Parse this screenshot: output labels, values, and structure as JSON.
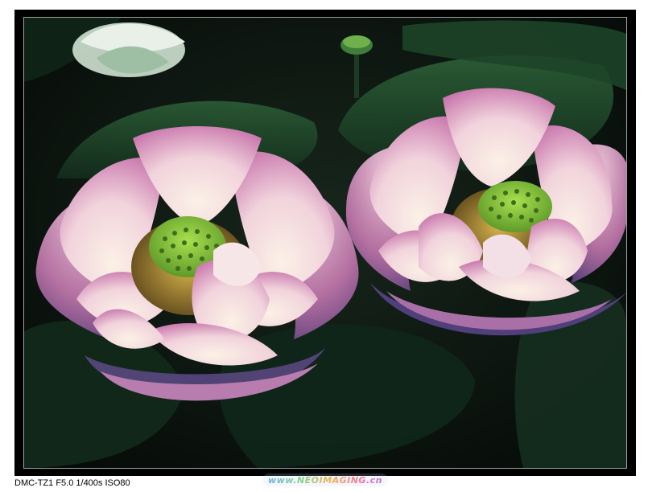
{
  "caption": {
    "camera_info": "DMC-TZ1 F5.0 1/400s ISO80",
    "watermark": "www.NEOIMAGING.cn"
  },
  "colors": {
    "frame": "#000000",
    "background": "#ffffff",
    "foliage_dark": "#0c1410",
    "leaf_green": "#1f4a2c",
    "petal_pink": "#d98fc0",
    "petal_light": "#f4e2e6",
    "seed_pod": "#7cc23a",
    "stamen": "#b89a3c"
  }
}
